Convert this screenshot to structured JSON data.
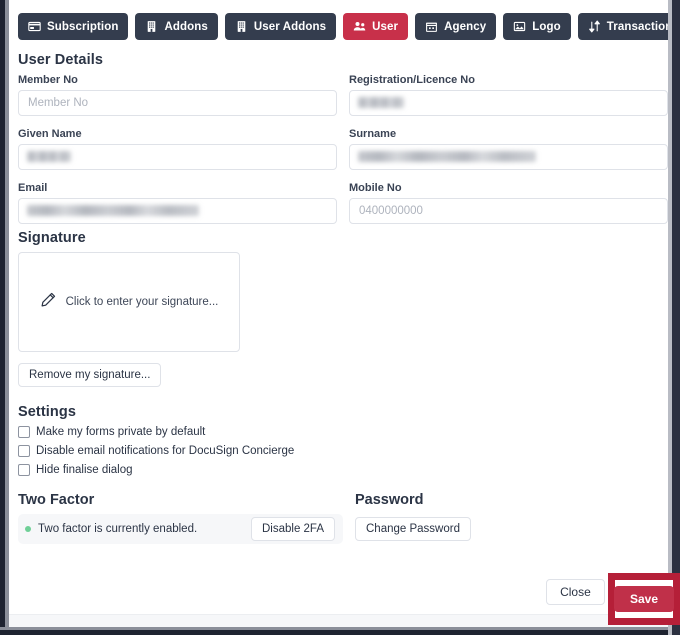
{
  "tabs": [
    {
      "label": "Subscription",
      "icon": "credit-card-icon",
      "active": false
    },
    {
      "label": "Addons",
      "icon": "building-icon",
      "active": false
    },
    {
      "label": "User Addons",
      "icon": "building-icon",
      "active": false
    },
    {
      "label": "User",
      "icon": "users-icon",
      "active": true
    },
    {
      "label": "Agency",
      "icon": "office-icon",
      "active": false
    },
    {
      "label": "Logo",
      "icon": "image-icon",
      "active": false
    },
    {
      "label": "Transactions",
      "icon": "sort-arrows-icon",
      "active": false
    }
  ],
  "user_details": {
    "heading": "User Details",
    "fields": [
      {
        "label": "Member No",
        "value": "",
        "placeholder": "Member No",
        "redacted": false,
        "redact_width": 0
      },
      {
        "label": "Registration/Licence No",
        "value": "",
        "placeholder": "",
        "redacted": true,
        "redact_width": 46
      },
      {
        "label": "Given Name",
        "value": "",
        "placeholder": "",
        "redacted": true,
        "redact_width": 44
      },
      {
        "label": "Surname",
        "value": "",
        "placeholder": "",
        "redacted": true,
        "redact_width": 178
      },
      {
        "label": "Email",
        "value": "",
        "placeholder": "",
        "redacted": true,
        "redact_width": 172
      },
      {
        "label": "Mobile No",
        "value": "",
        "placeholder": "0400000000",
        "redacted": false,
        "redact_width": 0
      }
    ]
  },
  "signature": {
    "heading": "Signature",
    "hint": "Click to enter your signature...",
    "hint_icon": "pencil-icon",
    "remove_label": "Remove my signature..."
  },
  "settings": {
    "heading": "Settings",
    "options": [
      {
        "label": "Make my forms private by default",
        "checked": false
      },
      {
        "label": "Disable email notifications for DocuSign Concierge",
        "checked": false
      },
      {
        "label": "Hide finalise dialog",
        "checked": false
      }
    ]
  },
  "security": {
    "two_factor_heading": "Two Factor",
    "password_heading": "Password",
    "two_factor_status": "Two factor is currently enabled.",
    "two_factor_button": "Disable 2FA",
    "password_button": "Change Password"
  },
  "footer": {
    "close_label": "Close",
    "save_label": "Save"
  },
  "colors": {
    "accent_red": "#c8304a",
    "tab_dark": "#343d4e",
    "highlight_red": "#b51f38",
    "status_green": "#6fcf97"
  }
}
